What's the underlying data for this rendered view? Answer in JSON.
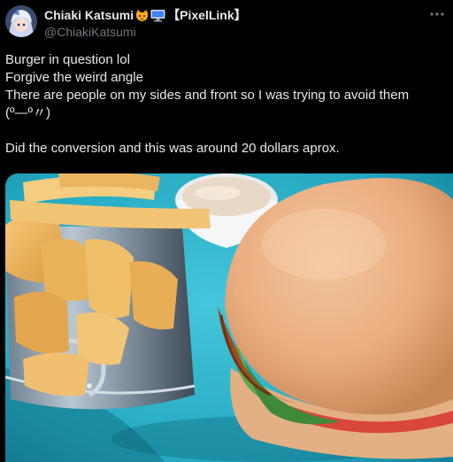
{
  "user": {
    "display_name": "Chiaki Katsumi",
    "tag": "【PixelLink】",
    "handle": "@ChiakiKatsumi",
    "badges": [
      "cat-face-emoji",
      "computer-monitor-emoji"
    ]
  },
  "post": {
    "lines": [
      "Burger in question lol",
      "Forgive the weird angle",
      "There are people on my sides and front so I was trying to avoid them",
      "(º—º〃)",
      "",
      "Did the conversion and this was around 20 dollars aprox."
    ]
  },
  "colors": {
    "background": "#000000",
    "text": "#e7e9ea",
    "muted": "#71767b",
    "plate": "#2bb3c9"
  },
  "icons": {
    "more": "more-horizontal-icon"
  }
}
